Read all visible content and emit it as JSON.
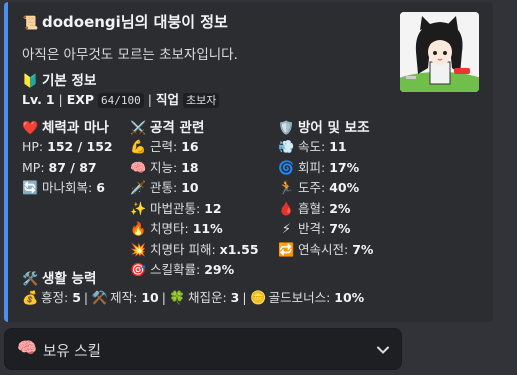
{
  "embed": {
    "accent_color": "#4d8ff0",
    "title_icon": "scroll-icon",
    "title": "dodoengi님의 대붕이 정보",
    "description": "아직은 아무것도 모르는 초보자입니다.",
    "basic": {
      "icon": "beginner-icon",
      "name": "기본 정보",
      "lv_label": "Lv.",
      "lv_value": "1",
      "sep1": "|",
      "exp_label": "EXP",
      "exp_value": "64/100",
      "sep2": "|",
      "job_label": "직업",
      "job_value": "초보자"
    },
    "hp_section": {
      "icon": "heart-icon",
      "name": "체력과 마나",
      "hp_label": "HP:",
      "hp_value": "152 / 152",
      "mp_label": "MP:",
      "mp_value": "87 / 87",
      "regen_label": "마나회복:",
      "regen_value": "6"
    },
    "attack": {
      "icon": "crossed-swords-icon",
      "name": "공격 관련",
      "stats": [
        {
          "icon": "muscle-icon",
          "label": "근력:",
          "value": "16"
        },
        {
          "icon": "brain-icon",
          "label": "지능:",
          "value": "18"
        },
        {
          "icon": "dagger-icon",
          "label": "관통:",
          "value": "10"
        },
        {
          "icon": "sparkles-icon",
          "label": "마법관통:",
          "value": "12"
        },
        {
          "icon": "fire-icon",
          "label": "치명타:",
          "value": "11%"
        },
        {
          "icon": "explosion-icon",
          "label": "치명타 피해:",
          "value": "x1.55"
        },
        {
          "icon": "target-icon",
          "label": "스킬확률:",
          "value": "29%"
        }
      ]
    },
    "defense": {
      "icon": "shield-icon",
      "name": "방어 및 보조",
      "stats": [
        {
          "icon": "dash-icon",
          "label": "속도:",
          "value": "11"
        },
        {
          "icon": "cyclone-icon",
          "label": "회피:",
          "value": "17%"
        },
        {
          "icon": "runner-icon",
          "label": "도주:",
          "value": "40%"
        },
        {
          "icon": "blood-drop-icon",
          "label": "흡혈:",
          "value": "2%"
        },
        {
          "icon": "lightning-icon",
          "label": "반격:",
          "value": "7%"
        },
        {
          "icon": "repeat-icon",
          "label": "연속시전:",
          "value": "7%"
        }
      ]
    },
    "life": {
      "icon": "tools-icon",
      "name": "생활 능력",
      "items": [
        {
          "icon": "money-bag-icon",
          "label": "흥정:",
          "value": "5",
          "sep": "|"
        },
        {
          "icon": "hammer-pick-icon",
          "label": "제작:",
          "value": "10",
          "sep": "|"
        },
        {
          "icon": "clover-icon",
          "label": "채집운:",
          "value": "3",
          "sep": "|"
        },
        {
          "icon": "coin-icon",
          "label": "골드보너스:",
          "value": "10%",
          "sep": ""
        }
      ]
    }
  },
  "skill_select": {
    "icon": "brain-icon",
    "placeholder": "보유 스킬",
    "chevron": "chevron-down-icon"
  }
}
